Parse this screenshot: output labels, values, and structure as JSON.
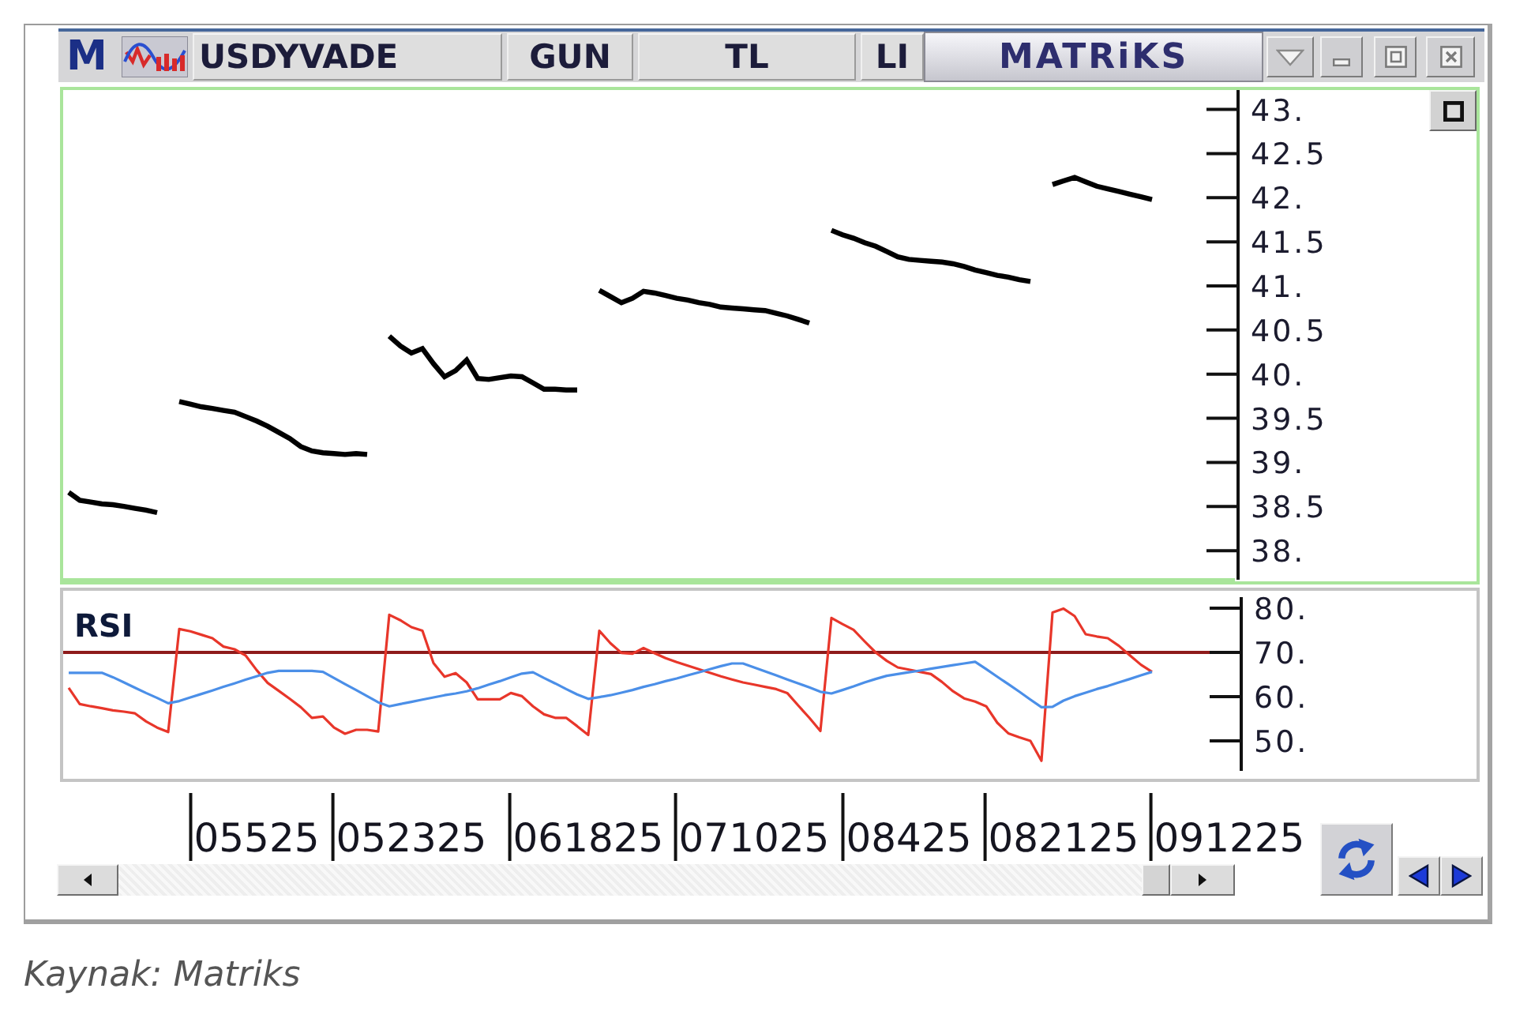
{
  "window": {
    "logo": "M",
    "tabs": [
      {
        "label": "USDYVADE"
      },
      {
        "label": "GUN"
      },
      {
        "label": "TL"
      },
      {
        "label": "LI"
      }
    ],
    "brand": "MATRiKS"
  },
  "price_panel": {
    "chart_data": {
      "type": "line",
      "categories": [
        null,
        null,
        null,
        null,
        null,
        null,
        null,
        null,
        null,
        null,
        null,
        null,
        null,
        null,
        null,
        null,
        null,
        null,
        null,
        null,
        null,
        null,
        null,
        null,
        null,
        null,
        null,
        null,
        null,
        null,
        null,
        null,
        null,
        null,
        null,
        null,
        null,
        null,
        null,
        null,
        null,
        null,
        null,
        null,
        null,
        null,
        null,
        null,
        null,
        null,
        null,
        null,
        null,
        null,
        null,
        null,
        null,
        null,
        null,
        null,
        null,
        null,
        null,
        null,
        null,
        null,
        null,
        null,
        null,
        null,
        null,
        null,
        null,
        null,
        null,
        null,
        null,
        null,
        null,
        null,
        null,
        null,
        null,
        null,
        null,
        null,
        null,
        null,
        null,
        null,
        null,
        null,
        null,
        null,
        null,
        null,
        null,
        null,
        null,
        null,
        null,
        null,
        null,
        null,
        null,
        null
      ],
      "series": [
        {
          "color": "#000000",
          "values": [
            38.66,
            38.57,
            38.55,
            38.53,
            38.52,
            38.5,
            38.48,
            38.46,
            38.43,
            null,
            39.69,
            39.66,
            39.63,
            39.61,
            39.59,
            39.57,
            39.52,
            39.47,
            39.41,
            39.34,
            39.27,
            39.18,
            39.13,
            39.11,
            39.1,
            39.09,
            39.1,
            39.09,
            null,
            40.43,
            40.32,
            40.24,
            40.29,
            40.12,
            39.97,
            40.04,
            40.16,
            39.95,
            39.94,
            39.96,
            39.98,
            39.97,
            39.9,
            39.83,
            39.83,
            39.82,
            39.82,
            null,
            40.95,
            40.88,
            40.81,
            40.86,
            40.94,
            40.92,
            40.89,
            40.86,
            40.84,
            40.81,
            40.79,
            40.76,
            40.75,
            40.74,
            40.73,
            40.72,
            40.69,
            40.66,
            40.62,
            40.58,
            null,
            41.63,
            41.58,
            41.54,
            41.49,
            41.45,
            41.39,
            41.33,
            41.3,
            41.29,
            41.28,
            41.27,
            41.25,
            41.22,
            41.18,
            41.15,
            41.12,
            41.1,
            41.07,
            41.05,
            null,
            42.15,
            42.19,
            42.23,
            42.18,
            42.13,
            42.1,
            42.07,
            42.04,
            42.01,
            41.98,
            null,
            null,
            null,
            null,
            null,
            null,
            null
          ]
        }
      ],
      "ylim": [
        37.67,
        43.22
      ],
      "yticks": [
        {
          "value": 43,
          "label": "43."
        },
        {
          "value": 42.5,
          "label": "42.5"
        },
        {
          "value": 42,
          "label": "42."
        },
        {
          "value": 41.5,
          "label": "41.5"
        },
        {
          "value": 41,
          "label": "41."
        },
        {
          "value": 40.5,
          "label": "40.5"
        },
        {
          "value": 40,
          "label": "40."
        },
        {
          "value": 39.5,
          "label": "39.5"
        },
        {
          "value": 39,
          "label": "39."
        },
        {
          "value": 38.5,
          "label": "38.5"
        },
        {
          "value": 38,
          "label": "38."
        }
      ]
    }
  },
  "rsi_panel": {
    "chart_data": {
      "type": "line",
      "title": "RSI",
      "categories": [
        null,
        null,
        null,
        null,
        null,
        null,
        null,
        null,
        null,
        null,
        null,
        null,
        null,
        null,
        null,
        null,
        null,
        "05525",
        null,
        null,
        null,
        null,
        null,
        null,
        null,
        null,
        null,
        null,
        null,
        null,
        null,
        "052325",
        null,
        null,
        null,
        null,
        null,
        null,
        null,
        null,
        null,
        null,
        null,
        null,
        null,
        null,
        null,
        "061825",
        null,
        null,
        null,
        null,
        null,
        null,
        null,
        null,
        null,
        null,
        null,
        null,
        null,
        null,
        "071025",
        null,
        null,
        null,
        null,
        null,
        null,
        null,
        null,
        null,
        null,
        null,
        null,
        null,
        "08425",
        null,
        null,
        null,
        null,
        null,
        null,
        null,
        null,
        null,
        null,
        null,
        null,
        null,
        "082125",
        null,
        null,
        null,
        null,
        null,
        null,
        null,
        null,
        null,
        null,
        null,
        null,
        null,
        null,
        "091225"
      ],
      "series": [
        {
          "color": "#e8362a",
          "values": [
            62.0,
            58.3,
            57.8,
            57.4,
            56.9,
            56.6,
            56.2,
            54.4,
            53.0,
            52.0,
            75.3,
            74.8,
            74.0,
            73.2,
            71.3,
            70.7,
            69.3,
            66.0,
            63.1,
            61.3,
            59.5,
            57.6,
            55.2,
            55.5,
            53.0,
            51.6,
            52.5,
            52.5,
            52.1,
            78.5,
            77.3,
            75.7,
            74.9,
            67.6,
            64.5,
            65.3,
            63.2,
            59.4,
            59.4,
            59.4,
            60.8,
            60.1,
            57.8,
            56.0,
            55.2,
            55.2,
            53.3,
            51.3,
            74.9,
            72.1,
            69.9,
            69.7,
            71.0,
            69.8,
            68.7,
            67.8,
            67.0,
            66.2,
            65.4,
            64.6,
            63.9,
            63.2,
            62.7,
            62.2,
            61.7,
            60.8,
            58.0,
            55.2,
            52.2,
            77.8,
            76.4,
            75.1,
            72.5,
            70.0,
            68.1,
            66.6,
            66.1,
            65.6,
            65.1,
            63.3,
            61.2,
            59.6,
            58.9,
            57.8,
            54.1,
            51.7,
            50.8,
            50.0,
            45.5,
            79.0,
            79.9,
            78.2,
            74.1,
            73.6,
            73.2,
            71.5,
            69.3,
            67.2,
            65.6,
            null,
            null,
            null,
            null,
            null,
            null,
            null
          ]
        },
        {
          "color": "#4b8fe8",
          "values": [
            65.4,
            65.4,
            65.4,
            65.4,
            64.4,
            63.2,
            62.0,
            60.8,
            59.7,
            58.5,
            59.0,
            59.8,
            60.6,
            61.4,
            62.2,
            63.0,
            63.8,
            64.6,
            65.4,
            65.8,
            65.8,
            65.8,
            65.8,
            65.6,
            64.2,
            62.8,
            61.5,
            60.1,
            58.7,
            57.8,
            58.3,
            58.8,
            59.3,
            59.8,
            60.3,
            60.7,
            61.2,
            61.9,
            62.7,
            63.5,
            64.4,
            65.2,
            65.5,
            64.2,
            63.0,
            61.7,
            60.5,
            59.5,
            59.9,
            60.3,
            60.9,
            61.5,
            62.2,
            62.8,
            63.5,
            64.1,
            64.8,
            65.5,
            66.2,
            66.9,
            67.5,
            67.5,
            66.6,
            65.7,
            64.8,
            63.9,
            63.0,
            62.1,
            61.1,
            60.7,
            61.5,
            62.3,
            63.2,
            64.0,
            64.7,
            65.1,
            65.5,
            65.9,
            66.3,
            66.7,
            67.1,
            67.5,
            67.9,
            66.2,
            64.5,
            62.8,
            61.1,
            59.3,
            57.6,
            57.7,
            59.1,
            60.1,
            60.9,
            61.7,
            62.4,
            63.2,
            64.0,
            64.8,
            65.6,
            null,
            null,
            null,
            null,
            null,
            null,
            null
          ]
        }
      ],
      "ylim": [
        43.2,
        82.5
      ],
      "yticks": [
        {
          "value": 80,
          "label": "80."
        },
        {
          "value": 70,
          "label": "70."
        },
        {
          "value": 60,
          "label": "60."
        },
        {
          "value": 50,
          "label": "50."
        }
      ],
      "ref_lines": [
        {
          "axis": "y",
          "value": 70
        }
      ]
    }
  },
  "caption": "Kaynak: Matriks"
}
